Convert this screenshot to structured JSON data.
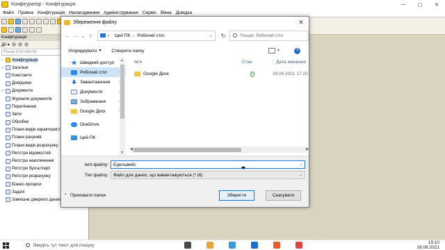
{
  "app": {
    "title": "Конфігуратор - Конфігурація",
    "window_controls": [
      "—",
      "▢",
      "✕"
    ],
    "menu": [
      "Файл",
      "Правка",
      "Конфігурація",
      "Налагодження",
      "Адміністрування",
      "Сервіс",
      "Вікна",
      "Довідка"
    ]
  },
  "config_panel": {
    "header": "Конфігурація",
    "actions_label": "Дії ▾",
    "search_placeholder": "Пошук (Ctrl+Alt+M)",
    "tree": [
      {
        "label": "Конфігурація",
        "twisty": "−",
        "root": true
      },
      {
        "label": "Загальні",
        "twisty": "+"
      },
      {
        "label": "Константи",
        "twisty": ""
      },
      {
        "label": "Довідники",
        "twisty": ""
      },
      {
        "label": "Документи",
        "twisty": "+"
      },
      {
        "label": "Журнали документів",
        "twisty": ""
      },
      {
        "label": "Перелічення",
        "twisty": ""
      },
      {
        "label": "Звіти",
        "twisty": ""
      },
      {
        "label": "Обробки",
        "twisty": ""
      },
      {
        "label": "Плани видів характеристик",
        "twisty": ""
      },
      {
        "label": "Плани рахунків",
        "twisty": ""
      },
      {
        "label": "Плани видів розрахунку",
        "twisty": ""
      },
      {
        "label": "Регістри відомостей",
        "twisty": ""
      },
      {
        "label": "Регістри накопичення",
        "twisty": ""
      },
      {
        "label": "Регістри бухгалтерії",
        "twisty": ""
      },
      {
        "label": "Регістри розрахунку",
        "twisty": ""
      },
      {
        "label": "Бізнес-процеси",
        "twisty": ""
      },
      {
        "label": "Задачі",
        "twisty": ""
      },
      {
        "label": "Зовнішнє джерело даних",
        "twisty": ""
      }
    ]
  },
  "dialog": {
    "title": "Збереження файлу",
    "close": "✕",
    "nav": {
      "back": "←",
      "forward": "→",
      "up": "↑",
      "recent": "⌄"
    },
    "breadcrumb": [
      "Цей ПК",
      "Робочий стіл"
    ],
    "search_placeholder": "Пошук: Робочий стіл",
    "organize_label": "Упорядкувати",
    "new_folder_label": "Створити папку",
    "help": "?",
    "nav_pane": [
      {
        "label": "Швидкий доступ",
        "icon": "star-icon",
        "cls": "star",
        "pinned": false,
        "selected": false
      },
      {
        "label": "Робочий стіл",
        "icon": "desktop-icon",
        "cls": "desk",
        "pinned": true,
        "selected": true
      },
      {
        "label": "Завантаження",
        "icon": "download-icon",
        "cls": "dl",
        "pinned": true,
        "selected": false
      },
      {
        "label": "Документи",
        "icon": "document-icon",
        "cls": "doc",
        "pinned": true,
        "selected": false
      },
      {
        "label": "Зображення",
        "icon": "pictures-icon",
        "cls": "img",
        "pinned": true,
        "selected": false
      },
      {
        "label": "Google Диск",
        "icon": "drive-icon",
        "cls": "gd",
        "pinned": true,
        "selected": false
      },
      {
        "label": "OneDrive",
        "icon": "onedrive-icon",
        "cls": "cloud",
        "pinned": false,
        "selected": false,
        "gap": true
      },
      {
        "label": "Цей ПК",
        "icon": "computer-icon",
        "cls": "pc2",
        "pinned": false,
        "selected": false,
        "gap": true
      }
    ],
    "columns": {
      "name": "Ім'я",
      "status": "Стан",
      "date": "Дата змінення"
    },
    "files": [
      {
        "name": "Google Диск",
        "status_icon": "synced-check-icon",
        "date": "28.06.2021 17:20"
      }
    ],
    "file_name_label": "Ім'я файлу:",
    "file_name_value": "Едельвейс",
    "file_type_label": "Тип файлу:",
    "file_type_value": "Файл для даних, що вивантажуються (*.dt)",
    "hide_folders_label": "Приховати папки",
    "save_label": "Зберегти",
    "cancel_label": "Скасувати"
  },
  "taskbar": {
    "search_text": "Введіть тут текст для пошуку",
    "time": "19:10",
    "date": "28.06.2021"
  },
  "colors": {
    "accent": "#0078d7",
    "selection": "#cce4f7",
    "workspace": "#d9d4c0"
  }
}
